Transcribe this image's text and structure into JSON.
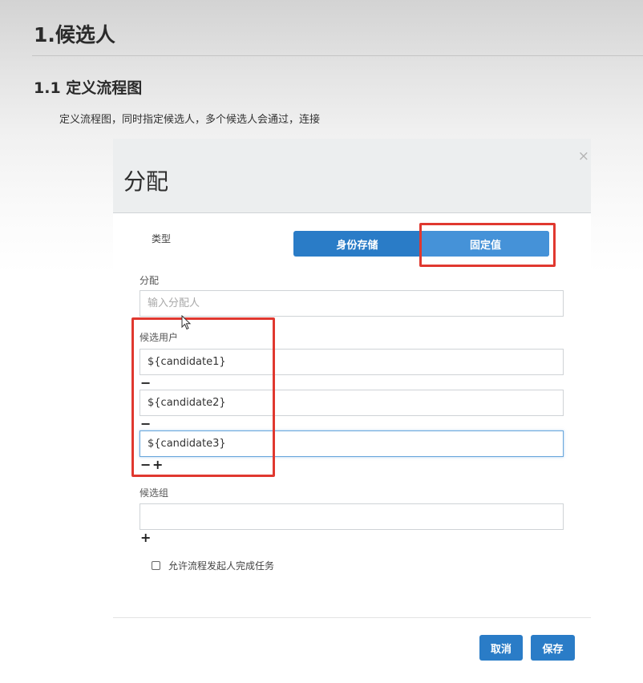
{
  "doc": {
    "heading1": "1.候选人",
    "heading2": "1.1 定义流程图",
    "description": "定义流程图，同时指定候选人，多个候选人会通过，连接"
  },
  "modal": {
    "title": "分配",
    "close_icon": "×",
    "type_label": "类型",
    "type_options": [
      {
        "label": "身份存储",
        "active": false
      },
      {
        "label": "固定值",
        "active": true
      }
    ],
    "assignee": {
      "label": "分配",
      "placeholder": "输入分配人",
      "value": ""
    },
    "candidate_users": {
      "label": "候选用户",
      "values": [
        "${candidate1}",
        "${candidate2}",
        "${candidate3}"
      ],
      "remove_symbol": "−",
      "add_symbol": "+"
    },
    "candidate_groups": {
      "label": "候选组",
      "value": "",
      "add_symbol": "+"
    },
    "allow_initiator": {
      "label": "允许流程发起人完成任务",
      "checked": false
    },
    "cancel_label": "取消",
    "save_label": "保存"
  },
  "colors": {
    "primary": "#2a7cc7",
    "highlight": "#e0382f"
  }
}
